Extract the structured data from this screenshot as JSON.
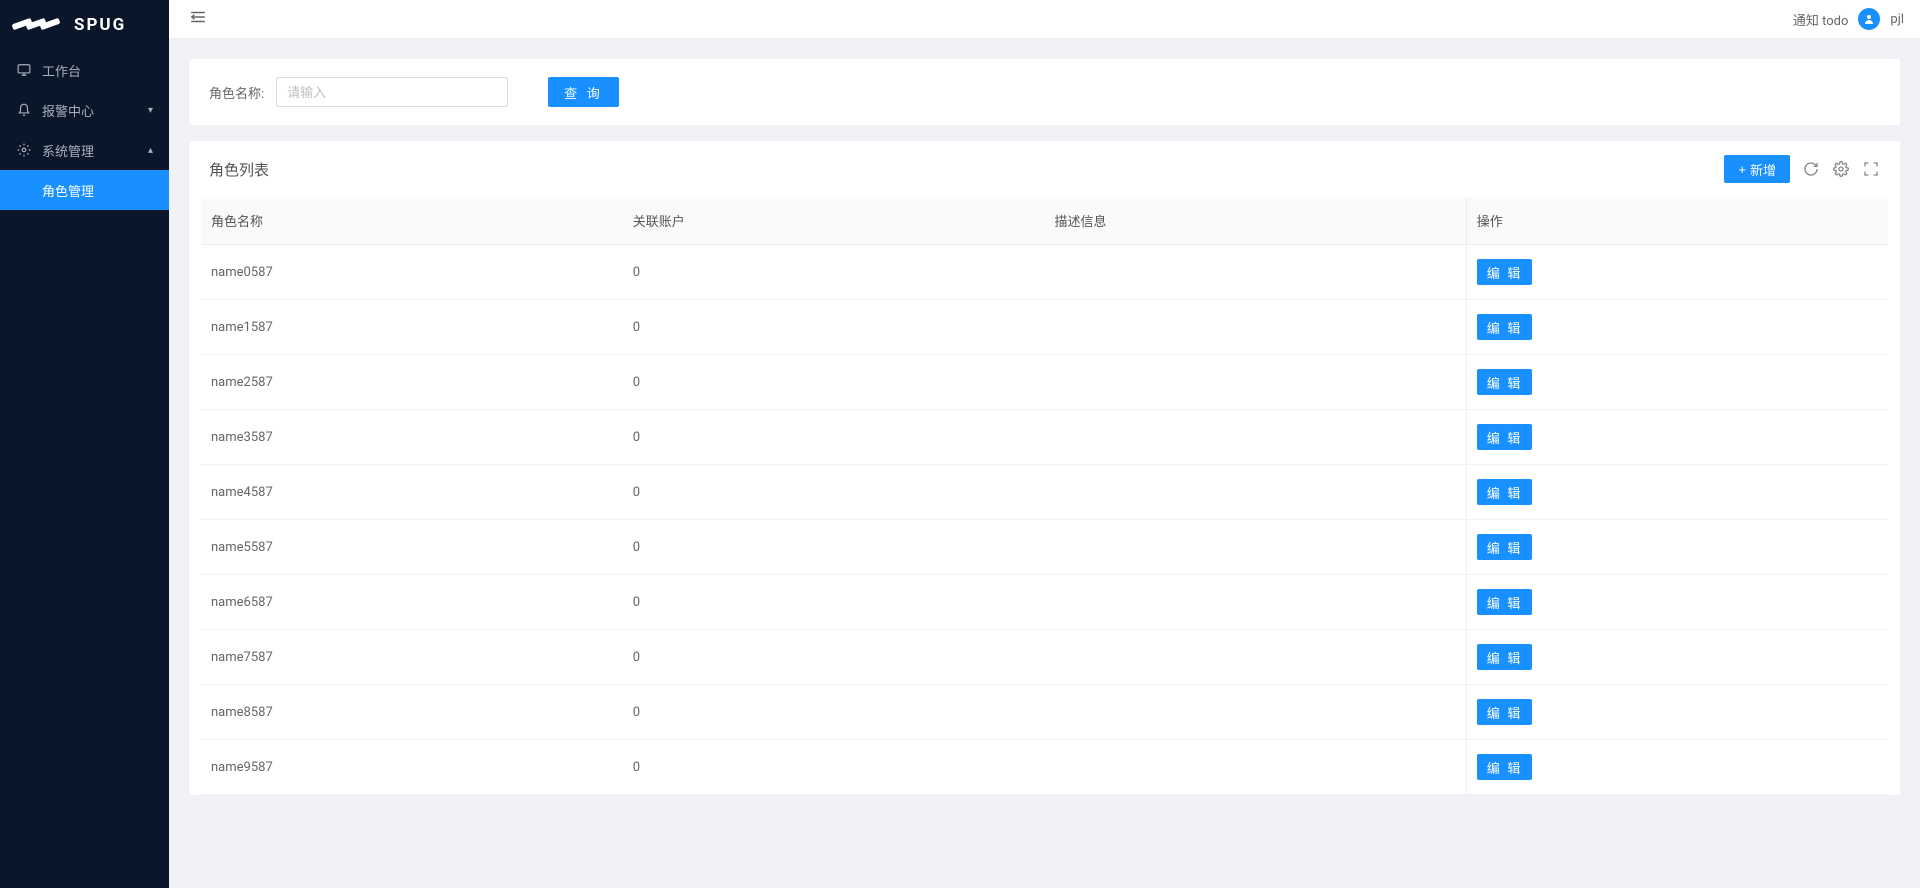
{
  "logo": {
    "text": "SPUG"
  },
  "header": {
    "notify": "通知 todo",
    "username": "pjl"
  },
  "sidebar": {
    "items": [
      {
        "icon": "desktop",
        "label": "工作台",
        "type": "item"
      },
      {
        "icon": "alert",
        "label": "报警中心",
        "type": "submenu",
        "expanded": false
      },
      {
        "icon": "setting",
        "label": "系统管理",
        "type": "submenu",
        "expanded": true,
        "children": [
          {
            "label": "角色管理",
            "active": true
          }
        ]
      }
    ]
  },
  "search": {
    "label": "角色名称:",
    "placeholder": "请输入",
    "query_btn": "查 询"
  },
  "table": {
    "title": "角色列表",
    "add_btn": "新增",
    "columns": [
      "角色名称",
      "关联账户",
      "描述信息",
      "操作"
    ],
    "edit_btn": "编 辑",
    "rows": [
      {
        "name": "name0587",
        "account": "0",
        "desc": ""
      },
      {
        "name": "name1587",
        "account": "0",
        "desc": ""
      },
      {
        "name": "name2587",
        "account": "0",
        "desc": ""
      },
      {
        "name": "name3587",
        "account": "0",
        "desc": ""
      },
      {
        "name": "name4587",
        "account": "0",
        "desc": ""
      },
      {
        "name": "name5587",
        "account": "0",
        "desc": ""
      },
      {
        "name": "name6587",
        "account": "0",
        "desc": ""
      },
      {
        "name": "name7587",
        "account": "0",
        "desc": ""
      },
      {
        "name": "name8587",
        "account": "0",
        "desc": ""
      },
      {
        "name": "name9587",
        "account": "0",
        "desc": ""
      }
    ]
  }
}
